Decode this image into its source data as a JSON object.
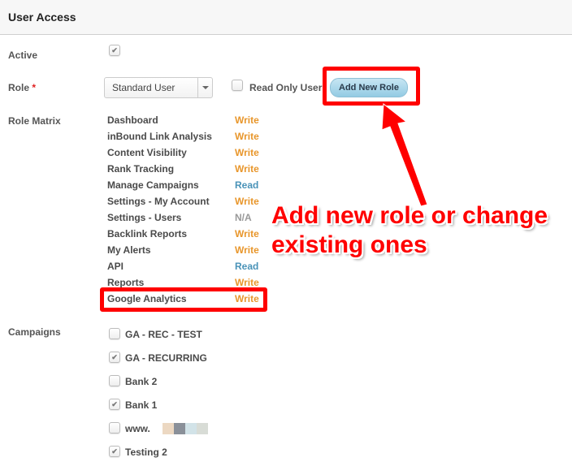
{
  "header": {
    "title": "User Access"
  },
  "active": {
    "label": "Active",
    "checked": true
  },
  "role": {
    "label": "Role",
    "required_mark": "*",
    "selected": "Standard User",
    "read_only_label": "Read Only User",
    "read_only_checked": false,
    "add_button": "Add New Role"
  },
  "role_matrix": {
    "label": "Role Matrix",
    "items": [
      {
        "name": "Dashboard",
        "access": "Write"
      },
      {
        "name": "inBound Link Analysis",
        "access": "Write"
      },
      {
        "name": "Content Visibility",
        "access": "Write"
      },
      {
        "name": "Rank Tracking",
        "access": "Write"
      },
      {
        "name": "Manage Campaigns",
        "access": "Read"
      },
      {
        "name": "Settings - My Account",
        "access": "Write"
      },
      {
        "name": "Settings - Users",
        "access": "N/A"
      },
      {
        "name": "Backlink Reports",
        "access": "Write"
      },
      {
        "name": "My Alerts",
        "access": "Write"
      },
      {
        "name": "API",
        "access": "Read"
      },
      {
        "name": "Reports",
        "access": "Write"
      },
      {
        "name": "Google Analytics",
        "access": "Write"
      }
    ]
  },
  "campaigns": {
    "label": "Campaigns",
    "items": [
      {
        "name": "GA - REC - TEST",
        "checked": false
      },
      {
        "name": "GA - RECURRING",
        "checked": true
      },
      {
        "name": "Bank 2",
        "checked": false
      },
      {
        "name": "Bank 1",
        "checked": true
      },
      {
        "name": "www.",
        "checked": false
      },
      {
        "name": "Testing 2",
        "checked": true
      }
    ]
  },
  "annotation": {
    "text_line1": "Add new role or change",
    "text_line2": "existing ones"
  },
  "colors": {
    "write": "#e8962b",
    "read": "#4a93b8",
    "na": "#999999",
    "annotation": "#ff0000"
  }
}
